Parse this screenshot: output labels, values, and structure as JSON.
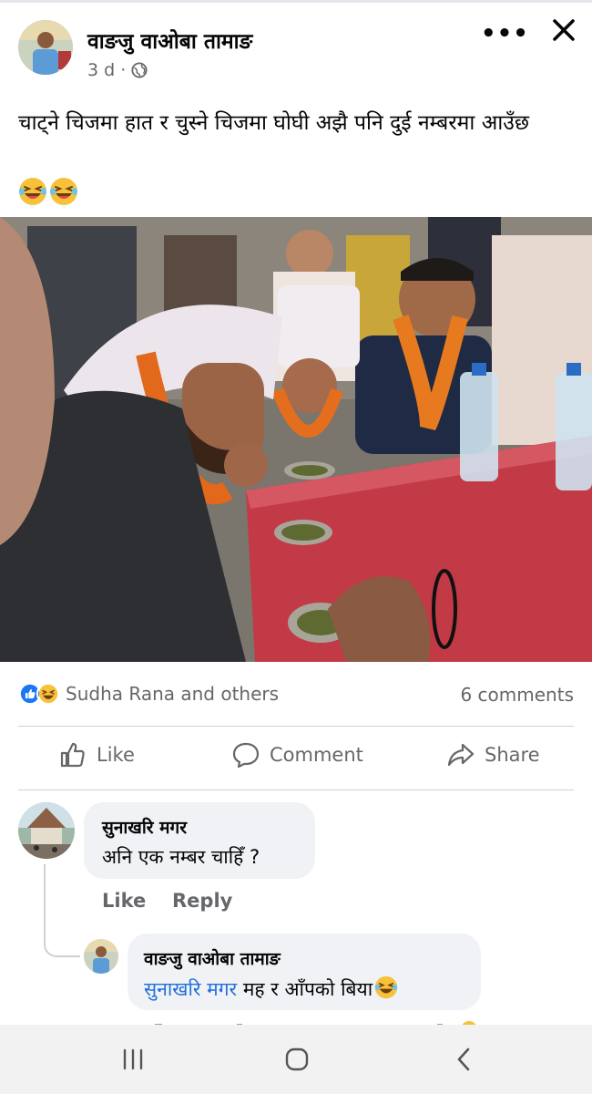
{
  "post": {
    "author": "वाङजु वाओबा तामाङ",
    "time": "3 d ·",
    "text": "चाट्ने चिजमा हात र चुस्ने चिजमा घोघी अझै पनि दुई नम्बरमा आउँछ",
    "emojis": [
      "laughing-emoji",
      "laughing-emoji"
    ]
  },
  "icons": {
    "more": "•••",
    "close": "close-icon",
    "privacy": "globe-icon"
  },
  "reactions": {
    "names": "Sudha Rana and others",
    "comments": "6 comments",
    "icons": [
      "like-reaction-icon",
      "haha-reaction-icon"
    ]
  },
  "actions": {
    "like": "Like",
    "comment": "Comment",
    "share": "Share"
  },
  "comments": [
    {
      "author": "सुनाखरि मगर",
      "text": "अनि एक नम्बर चाहिँ ?",
      "like": "Like",
      "reply": "Reply"
    },
    {
      "author": "वाङजु वाओबा तामाङ",
      "mention": "सुनाखरि मगर",
      "text": " मह र आँपको बिया"
    }
  ],
  "colors": {
    "accent": "#216fdb",
    "meta": "#65676b",
    "bubble": "#f0f2f5"
  }
}
